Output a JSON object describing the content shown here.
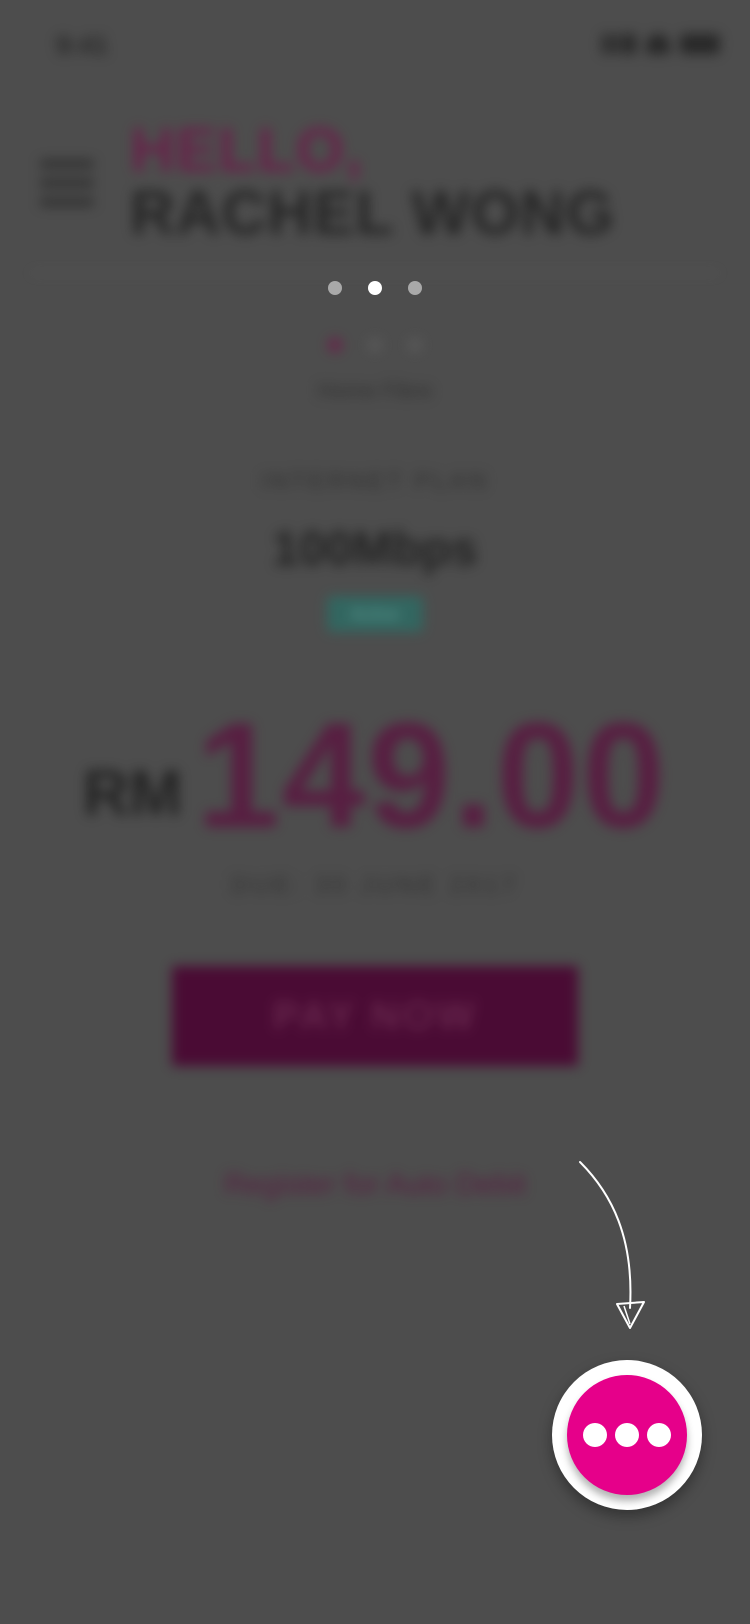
{
  "status_bar": {
    "time": "9:41"
  },
  "header": {
    "greeting": "HELLO,",
    "user_name": "RACHEL WONG"
  },
  "carousel": {
    "page_count": 3,
    "active_index": 1
  },
  "account": {
    "inner_page_count": 3,
    "inner_active_index": 0,
    "label": "Home Fibre"
  },
  "plan": {
    "label": "INTERNET PLAN",
    "speed": "100Mbps",
    "badge": "Active"
  },
  "billing": {
    "currency": "RM",
    "amount": "149.00",
    "due_date": "DUE: 30 JUNE 2017"
  },
  "actions": {
    "pay_label": "PAY NOW",
    "autodebit_label": "Register for Auto Debit"
  },
  "colors": {
    "overlay": "#4d4d4d",
    "fab": "#e6008a",
    "brand_magenta": "#5a1740"
  },
  "icons": {
    "fab": "more-horizontal-icon",
    "hint": "hand-drawn-arrow-icon",
    "menu": "hamburger-menu-icon"
  }
}
